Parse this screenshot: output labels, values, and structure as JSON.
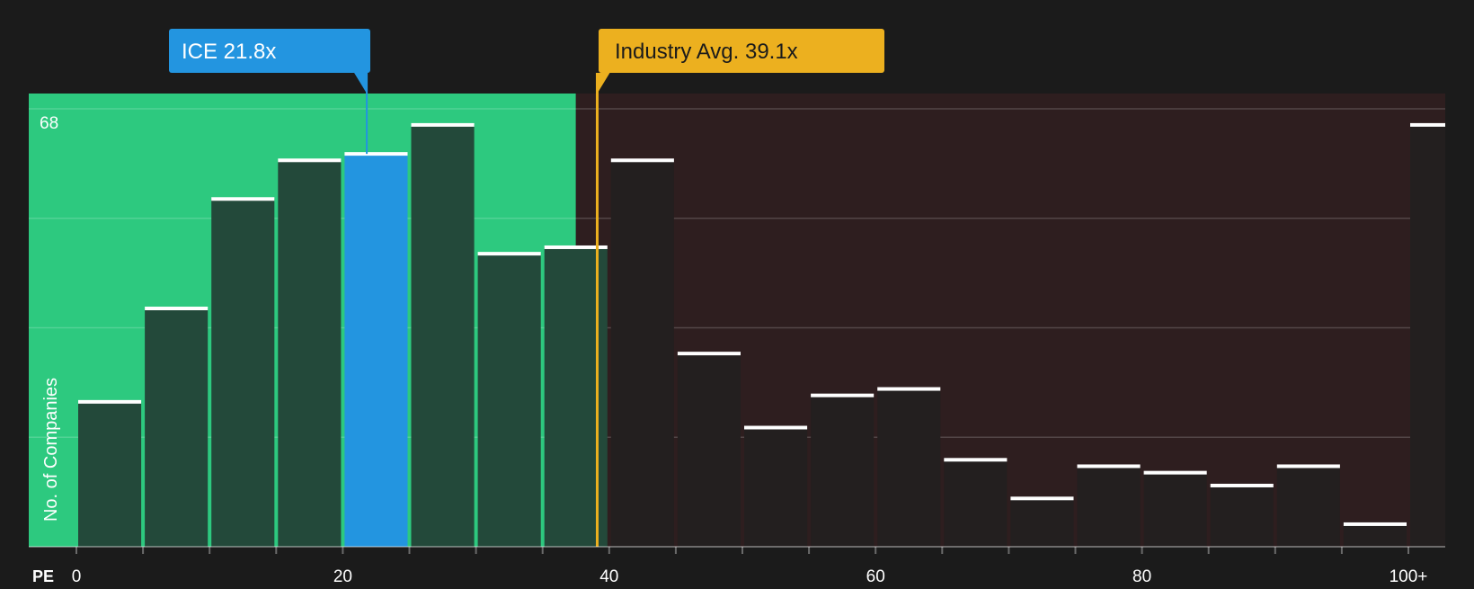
{
  "colors": {
    "background": "#1b1b1b",
    "below_avg_region": "#2dc97f",
    "above_avg_region": "#2e1e1f",
    "bar_below": "#23493a",
    "bar_above": "#231f1f",
    "bar_company": "#2395e0",
    "company_callout": "#2395e0",
    "industry_callout": "#ecb01f",
    "bar_cap": "#ffffff",
    "axis_text": "#ffffff"
  },
  "chart_data": {
    "type": "bar",
    "metric_label": "PE",
    "ylabel": "No. of Companies",
    "ymax_label": "68",
    "ylim": [
      0,
      68
    ],
    "xlim": [
      0,
      100
    ],
    "bin_width": 5,
    "x_ticks": [
      0,
      20,
      40,
      60,
      80,
      100
    ],
    "x_tick_labels": [
      "0",
      "20",
      "40",
      "60",
      "80",
      "100+"
    ],
    "bins": [
      {
        "x_start": 0,
        "value": 22.5
      },
      {
        "x_start": 5,
        "value": 37
      },
      {
        "x_start": 10,
        "value": 54
      },
      {
        "x_start": 15,
        "value": 60
      },
      {
        "x_start": 20,
        "value": 61
      },
      {
        "x_start": 25,
        "value": 65.5
      },
      {
        "x_start": 30,
        "value": 45.5
      },
      {
        "x_start": 35,
        "value": 46.5
      },
      {
        "x_start": 40,
        "value": 60
      },
      {
        "x_start": 45,
        "value": 30
      },
      {
        "x_start": 50,
        "value": 18.5
      },
      {
        "x_start": 55,
        "value": 23.5
      },
      {
        "x_start": 60,
        "value": 24.5
      },
      {
        "x_start": 65,
        "value": 13.5
      },
      {
        "x_start": 70,
        "value": 7.5
      },
      {
        "x_start": 75,
        "value": 12.5
      },
      {
        "x_start": 80,
        "value": 11.5
      },
      {
        "x_start": 85,
        "value": 9.5
      },
      {
        "x_start": 90,
        "value": 12.5
      },
      {
        "x_start": 95,
        "value": 3.5
      },
      {
        "x_start": 100,
        "value": 65.5
      }
    ],
    "company": {
      "name": "ICE",
      "value": 21.8,
      "label": "ICE 21.8x"
    },
    "industry_avg": {
      "value": 39.1,
      "label": "Industry Avg. 39.1x"
    },
    "below_region_end": 37.5
  }
}
